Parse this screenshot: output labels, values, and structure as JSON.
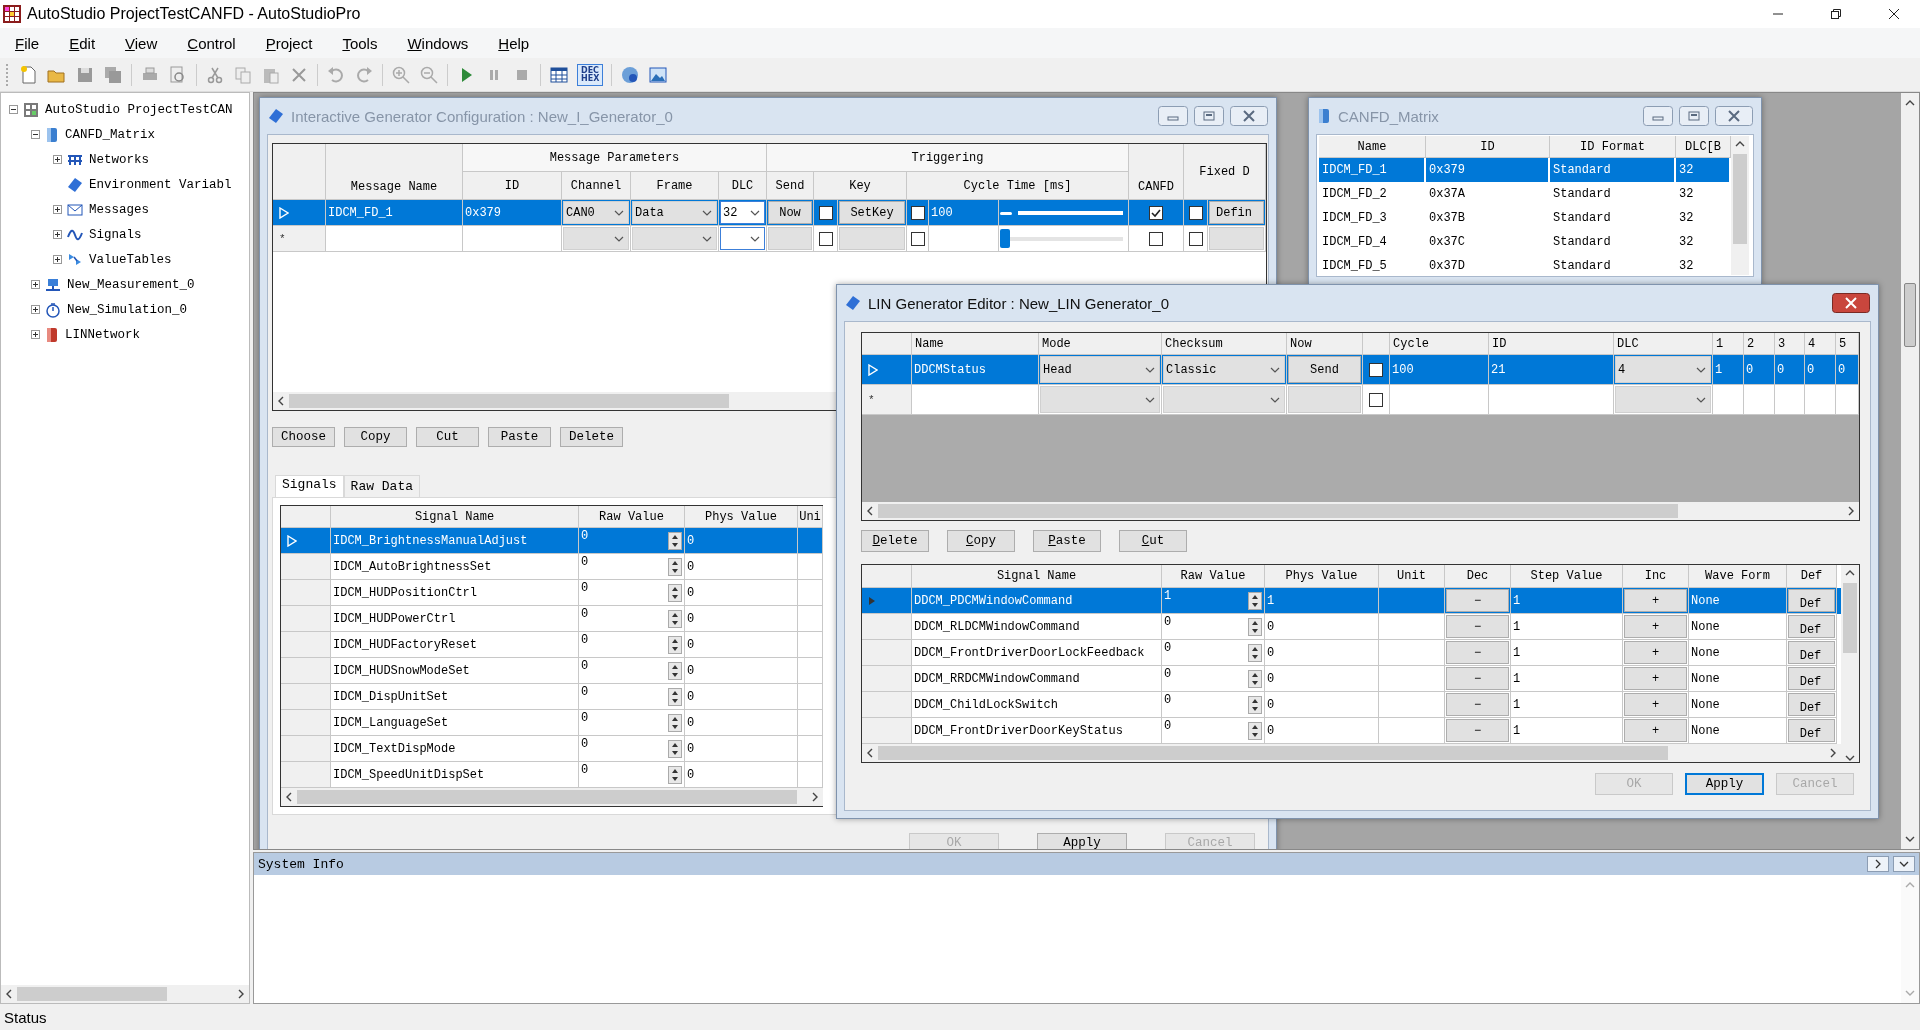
{
  "window": {
    "title": "AutoStudio ProjectTestCANFD - AutoStudioPro"
  },
  "menu": [
    "File",
    "Edit",
    "View",
    "Control",
    "Project",
    "Tools",
    "Windows",
    "Help"
  ],
  "toolbar": {
    "number_format_toggle": {
      "lines": [
        "DEC",
        "HEX"
      ],
      "selected": true
    }
  },
  "tree": [
    {
      "label": "AutoStudio ProjectTestCAN",
      "kind": "project",
      "expandable": true,
      "expanded": true,
      "children": [
        {
          "label": "CANFD_Matrix",
          "kind": "database",
          "expandable": true,
          "expanded": true,
          "children": [
            {
              "label": "Networks",
              "kind": "networks",
              "expandable": true,
              "expanded": false
            },
            {
              "label": "Environment Variabl",
              "kind": "variable",
              "expandable": false
            },
            {
              "label": "Messages",
              "kind": "messages",
              "expandable": true,
              "expanded": false
            },
            {
              "label": "Signals",
              "kind": "signals",
              "expandable": true,
              "expanded": false
            },
            {
              "label": "ValueTables",
              "kind": "valuetables",
              "expandable": true,
              "expanded": false
            }
          ]
        },
        {
          "label": "New_Measurement_0",
          "kind": "measurement",
          "expandable": true,
          "expanded": false
        },
        {
          "label": "New_Simulation_0",
          "kind": "simulation",
          "expandable": true,
          "expanded": false
        },
        {
          "label": "LINNetwork",
          "kind": "lin",
          "expandable": true,
          "expanded": false
        }
      ]
    }
  ],
  "generator_window": {
    "title": "Interactive Generator Configuration : New_I_Generator_0",
    "active": false,
    "minimize_maximize": true,
    "column_groups": [
      "Message Parameters",
      "Triggering"
    ],
    "columns": [
      "Message Name",
      "ID",
      "Channel",
      "Frame",
      "DLC",
      "Send",
      "Key",
      "Cycle Time [ms]",
      "CANFD",
      "Fixed D"
    ],
    "rows": [
      {
        "kind": "data",
        "selected": true,
        "message_name": "IDCM_FD_1",
        "id": "0x379",
        "channel": "CAN0",
        "frame": "Data",
        "dlc": "32",
        "send": "Now",
        "key_enabled": false,
        "key": "SetKey",
        "cycle_enabled": false,
        "cycle_time": "100",
        "level": 0,
        "canfd": true,
        "fixed": false,
        "fixed_button": "Defin"
      },
      {
        "kind": "new",
        "marker": "*",
        "selected": false,
        "key_enabled": false,
        "cycle_enabled": false,
        "level": 0,
        "canfd": false,
        "fixed": false
      }
    ],
    "buttons": [
      "Choose",
      "Copy",
      "Cut",
      "Paste",
      "Delete"
    ],
    "tabs": [
      {
        "label": "Signals",
        "selected": true
      },
      {
        "label": "Raw Data",
        "selected": false
      }
    ],
    "signal_columns": [
      "Signal Name",
      "Raw Value",
      "Phys Value",
      "Uni"
    ],
    "signals": [
      {
        "name": "IDCM_BrightnessManualAdjust",
        "raw": "0",
        "phys": "0",
        "selected": true
      },
      {
        "name": "IDCM_AutoBrightnessSet",
        "raw": "0",
        "phys": "0",
        "selected": false
      },
      {
        "name": "IDCM_HUDPositionCtrl",
        "raw": "0",
        "phys": "0",
        "selected": false
      },
      {
        "name": "IDCM_HUDPowerCtrl",
        "raw": "0",
        "phys": "0",
        "selected": false
      },
      {
        "name": "IDCM_HUDFactoryReset",
        "raw": "0",
        "phys": "0",
        "selected": false
      },
      {
        "name": "IDCM_HUDSnowModeSet",
        "raw": "0",
        "phys": "0",
        "selected": false
      },
      {
        "name": "IDCM_DispUnitSet",
        "raw": "0",
        "phys": "0",
        "selected": false
      },
      {
        "name": "IDCM_LanguageSet",
        "raw": "0",
        "phys": "0",
        "selected": false
      },
      {
        "name": "IDCM_TextDispMode",
        "raw": "0",
        "phys": "0",
        "selected": false
      },
      {
        "name": "IDCM_SpeedUnitDispSet",
        "raw": "0",
        "phys": "0",
        "selected": false
      }
    ],
    "dialog_buttons": [
      {
        "label": "OK",
        "disabled": true,
        "default": false
      },
      {
        "label": "Apply",
        "disabled": false,
        "default": false
      },
      {
        "label": "Cancel",
        "disabled": true,
        "default": false
      }
    ]
  },
  "matrix_window": {
    "title": "CANFD_Matrix",
    "active": false,
    "minimize_maximize": true,
    "columns": [
      "Name",
      "ID",
      "ID Format",
      "DLC[B"
    ],
    "rows": [
      {
        "name": "IDCM_FD_1",
        "id": "0x379",
        "format": "Standard",
        "dlc": "32",
        "selected": true
      },
      {
        "name": "IDCM_FD_2",
        "id": "0x37A",
        "format": "Standard",
        "dlc": "32",
        "selected": false
      },
      {
        "name": "IDCM_FD_3",
        "id": "0x37B",
        "format": "Standard",
        "dlc": "32",
        "selected": false
      },
      {
        "name": "IDCM_FD_4",
        "id": "0x37C",
        "format": "Standard",
        "dlc": "32",
        "selected": false
      },
      {
        "name": "IDCM_FD_5",
        "id": "0x37D",
        "format": "Standard",
        "dlc": "32",
        "selected": false
      }
    ]
  },
  "lin_window": {
    "title": "LIN Generator Editor : New_LIN Generator_0",
    "active": true,
    "minimize_maximize": false,
    "columns": [
      "Name",
      "Mode",
      "Checksum",
      "Now",
      "Cycle",
      "ID",
      "DLC",
      "1",
      "2",
      "3",
      "4",
      "5"
    ],
    "rows": [
      {
        "kind": "data",
        "selected": true,
        "name": "DDCMStatus",
        "mode": "Head",
        "checksum": "Classic",
        "send": "Send",
        "enabled": false,
        "cycle": "100",
        "id": "21",
        "dlc": "4",
        "bytes": [
          "1",
          "0",
          "0",
          "0",
          "0"
        ]
      },
      {
        "kind": "new",
        "marker": "*",
        "selected": false,
        "enabled": false
      }
    ],
    "buttons": [
      "Delete",
      "Copy",
      "Paste",
      "Cut"
    ],
    "signal_columns": [
      "Signal Name",
      "Raw Value",
      "Phys Value",
      "Unit",
      "Dec",
      "Step Value",
      "Inc",
      "Wave Form",
      "Def"
    ],
    "signals": [
      {
        "name": "DDCM_PDCMWindowCommand",
        "raw": "1",
        "phys": "1",
        "dec": "−",
        "step": "1",
        "inc": "+",
        "wave": "None",
        "def": "Def",
        "selected": true
      },
      {
        "name": "DDCM_RLDCMWindowCommand",
        "raw": "0",
        "phys": "0",
        "dec": "−",
        "step": "1",
        "inc": "+",
        "wave": "None",
        "def": "Def",
        "selected": false
      },
      {
        "name": "DDCM_FrontDriverDoorLockFeedback",
        "raw": "0",
        "phys": "0",
        "dec": "−",
        "step": "1",
        "inc": "+",
        "wave": "None",
        "def": "Def",
        "selected": false
      },
      {
        "name": "DDCM_RRDCMWindowCommand",
        "raw": "0",
        "phys": "0",
        "dec": "−",
        "step": "1",
        "inc": "+",
        "wave": "None",
        "def": "Def",
        "selected": false
      },
      {
        "name": "DDCM_ChildLockSwitch",
        "raw": "0",
        "phys": "0",
        "dec": "−",
        "step": "1",
        "inc": "+",
        "wave": "None",
        "def": "Def",
        "selected": false
      },
      {
        "name": "DDCM_FrontDriverDoorKeyStatus",
        "raw": "0",
        "phys": "0",
        "dec": "−",
        "step": "1",
        "inc": "+",
        "wave": "None",
        "def": "Def",
        "selected": false
      }
    ],
    "dialog_buttons": [
      {
        "label": "OK",
        "disabled": true,
        "default": false
      },
      {
        "label": "Apply",
        "disabled": false,
        "default": true
      },
      {
        "label": "Cancel",
        "disabled": true,
        "default": false
      }
    ]
  },
  "system_info": {
    "title": "System Info"
  },
  "status_bar": "Status"
}
